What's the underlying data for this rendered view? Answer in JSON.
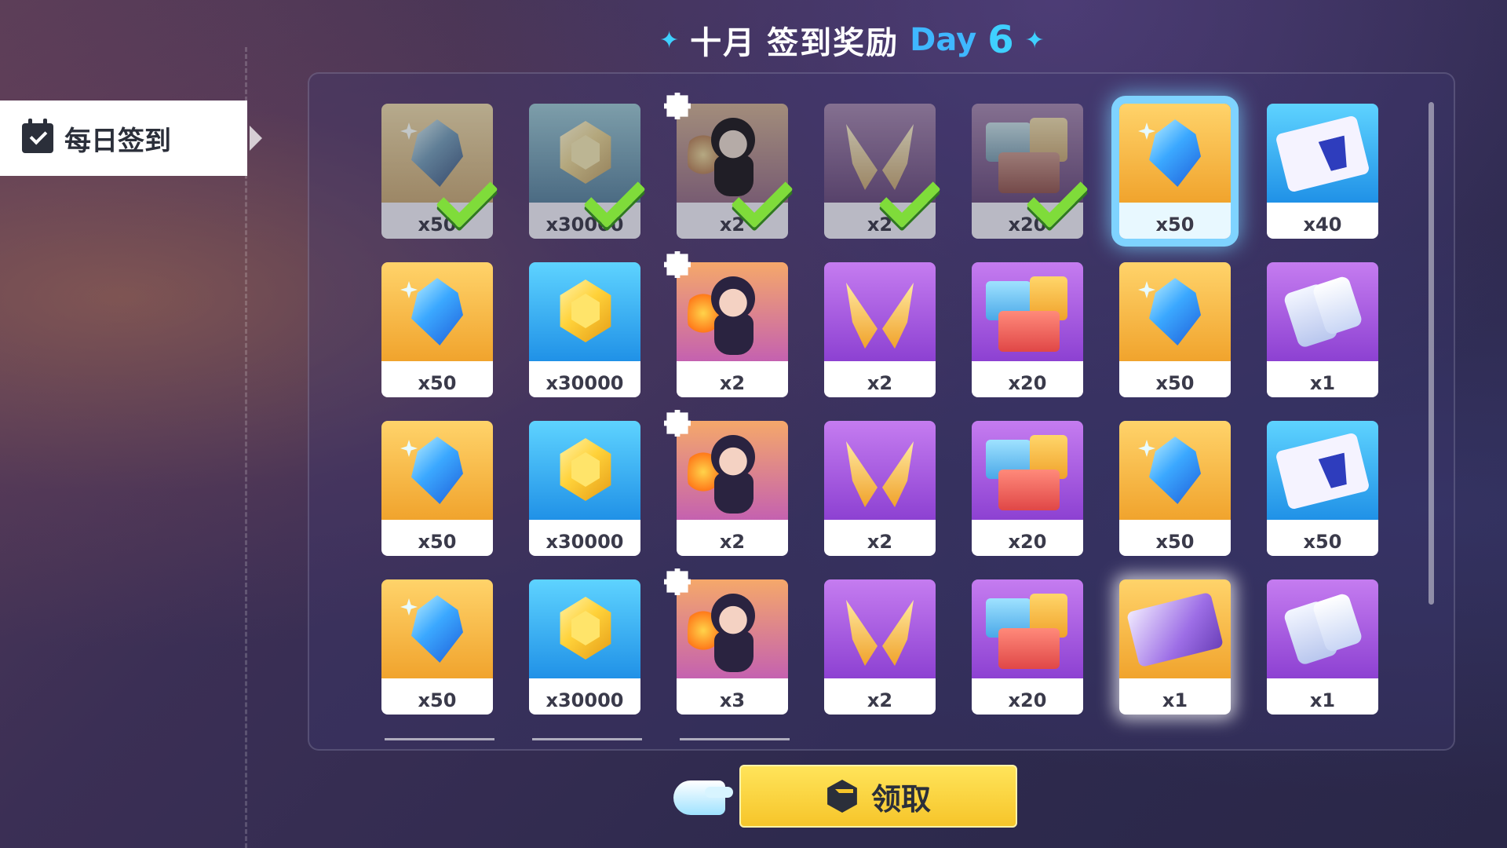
{
  "title": {
    "month": "十月",
    "text": "签到奖励",
    "day_label": "Day",
    "day_number": "6"
  },
  "sidebar": {
    "tab_label": "每日签到"
  },
  "claim_button": {
    "label": "领取"
  },
  "rewards": [
    [
      {
        "item": "crystal",
        "qty": "x50",
        "claimed": true
      },
      {
        "item": "coin",
        "qty": "x30000",
        "claimed": true
      },
      {
        "item": "character-fragment",
        "qty": "x2",
        "claimed": true
      },
      {
        "item": "golden-shard",
        "qty": "x2",
        "claimed": true
      },
      {
        "item": "building-blocks",
        "qty": "x20",
        "claimed": true
      },
      {
        "item": "crystal",
        "qty": "x50",
        "claimed": false,
        "current": true
      },
      {
        "item": "outfit-ticket",
        "qty": "x40",
        "claimed": false
      }
    ],
    [
      {
        "item": "crystal",
        "qty": "x50",
        "claimed": false
      },
      {
        "item": "coin",
        "qty": "x30000",
        "claimed": false
      },
      {
        "item": "character-fragment",
        "qty": "x2",
        "claimed": false
      },
      {
        "item": "golden-shard",
        "qty": "x2",
        "claimed": false
      },
      {
        "item": "building-blocks",
        "qty": "x20",
        "claimed": false
      },
      {
        "item": "crystal",
        "qty": "x50",
        "claimed": false
      },
      {
        "item": "supply-cups",
        "qty": "x1",
        "claimed": false
      }
    ],
    [
      {
        "item": "crystal",
        "qty": "x50",
        "claimed": false
      },
      {
        "item": "coin",
        "qty": "x30000",
        "claimed": false
      },
      {
        "item": "character-fragment",
        "qty": "x2",
        "claimed": false
      },
      {
        "item": "golden-shard",
        "qty": "x2",
        "claimed": false
      },
      {
        "item": "building-blocks",
        "qty": "x20",
        "claimed": false
      },
      {
        "item": "crystal",
        "qty": "x50",
        "claimed": false
      },
      {
        "item": "outfit-ticket",
        "qty": "x50",
        "claimed": false
      }
    ],
    [
      {
        "item": "crystal",
        "qty": "x50",
        "claimed": false
      },
      {
        "item": "coin",
        "qty": "x30000",
        "claimed": false
      },
      {
        "item": "character-fragment",
        "qty": "x3",
        "claimed": false
      },
      {
        "item": "golden-shard",
        "qty": "x2",
        "claimed": false
      },
      {
        "item": "building-blocks",
        "qty": "x20",
        "claimed": false
      },
      {
        "item": "purple-ticket",
        "qty": "x1",
        "claimed": false,
        "glow": true
      },
      {
        "item": "supply-cups",
        "qty": "x1",
        "claimed": false
      }
    ]
  ],
  "colors": {
    "accent_cyan": "#3fd0ff",
    "claim_yellow": "#f6c52a",
    "check_green": "#7fdc3a"
  }
}
